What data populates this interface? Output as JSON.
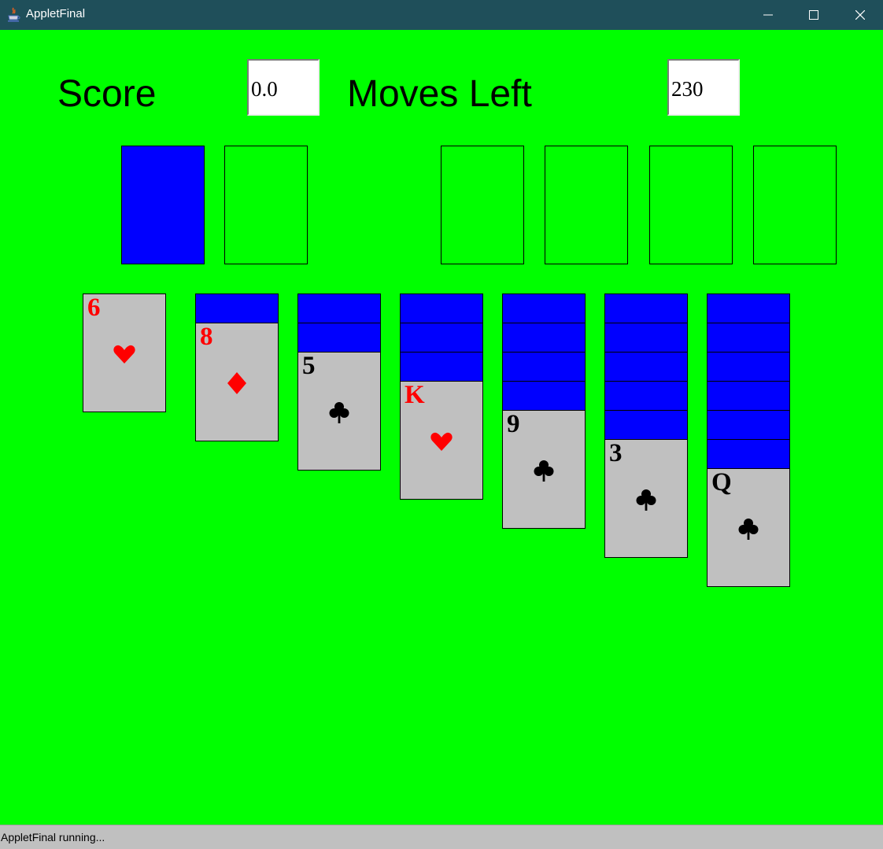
{
  "window": {
    "title": "AppletFinal"
  },
  "header": {
    "score_label": "Score",
    "score_value": "0.0",
    "moves_label": "Moves Left",
    "moves_value": "230"
  },
  "tableau": [
    {
      "hidden": 0,
      "rank": "6",
      "suit": "heart-icon",
      "color": "#ff0000"
    },
    {
      "hidden": 1,
      "rank": "8",
      "suit": "diamond-icon",
      "color": "#ff0000"
    },
    {
      "hidden": 2,
      "rank": "5",
      "suit": "club-icon",
      "color": "#000000"
    },
    {
      "hidden": 3,
      "rank": "K",
      "suit": "heart-icon",
      "color": "#ff0000"
    },
    {
      "hidden": 4,
      "rank": "9",
      "suit": "club-icon",
      "color": "#000000"
    },
    {
      "hidden": 5,
      "rank": "3",
      "suit": "club-icon",
      "color": "#000000"
    },
    {
      "hidden": 6,
      "rank": "Q",
      "suit": "club-icon",
      "color": "#000000"
    }
  ],
  "colors": {
    "table": "#00ff00",
    "card_back": "#0000ff",
    "card_face": "#c0c0c0",
    "titlebar": "#1f4f5a"
  },
  "status": {
    "text": "AppletFinal running..."
  }
}
